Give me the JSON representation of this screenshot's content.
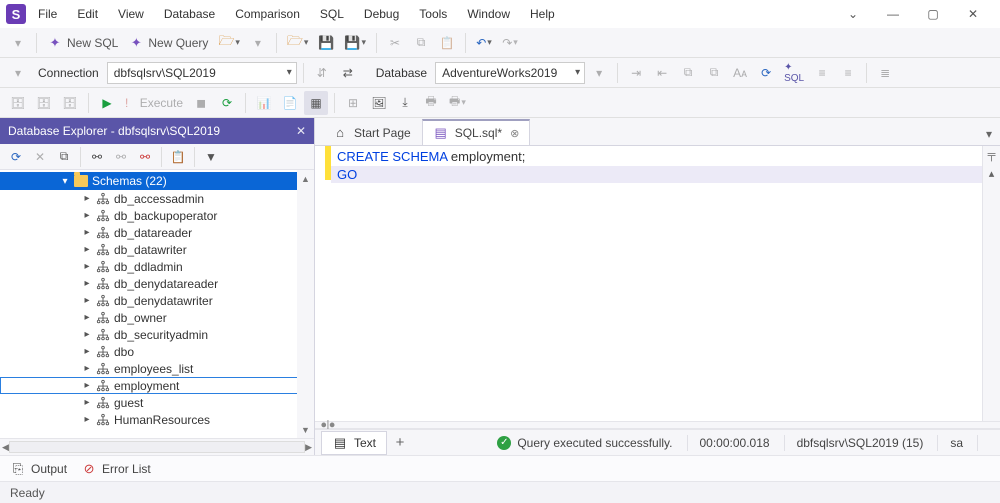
{
  "menu": {
    "items": [
      "File",
      "Edit",
      "View",
      "Database",
      "Comparison",
      "SQL",
      "Debug",
      "Tools",
      "Window",
      "Help"
    ]
  },
  "toolbar1": {
    "new_sql": "New SQL",
    "new_query": "New Query"
  },
  "toolbar2": {
    "connection_label": "Connection",
    "connection_value": "dbfsqlsrv\\SQL2019",
    "database_label": "Database",
    "database_value": "AdventureWorks2019"
  },
  "toolbar3": {
    "execute_label": "Execute"
  },
  "explorer": {
    "title": "Database Explorer - dbfsqlsrv\\SQL2019",
    "folder_label": "Schemas (22)",
    "schemas": [
      "db_accessadmin",
      "db_backupoperator",
      "db_datareader",
      "db_datawriter",
      "db_ddladmin",
      "db_denydatareader",
      "db_denydatawriter",
      "db_owner",
      "db_securityadmin",
      "dbo",
      "employees_list",
      "employment",
      "guest",
      "HumanResources"
    ],
    "highlighted_schema": "employment"
  },
  "tabs": {
    "start_page": "Start Page",
    "sql_tab": "SQL.sql*"
  },
  "code": {
    "line1_kw1": "CREATE",
    "line1_kw2": "SCHEMA",
    "line1_ident": "employment",
    "line2": "GO"
  },
  "result": {
    "tab_label": "Text",
    "status_msg": "Query executed successfully.",
    "elapsed": "00:00:00.018",
    "server": "dbfsqlsrv\\SQL2019 (15)",
    "user": "sa"
  },
  "bottom": {
    "output": "Output",
    "error_list": "Error List"
  },
  "status": {
    "text": "Ready"
  }
}
